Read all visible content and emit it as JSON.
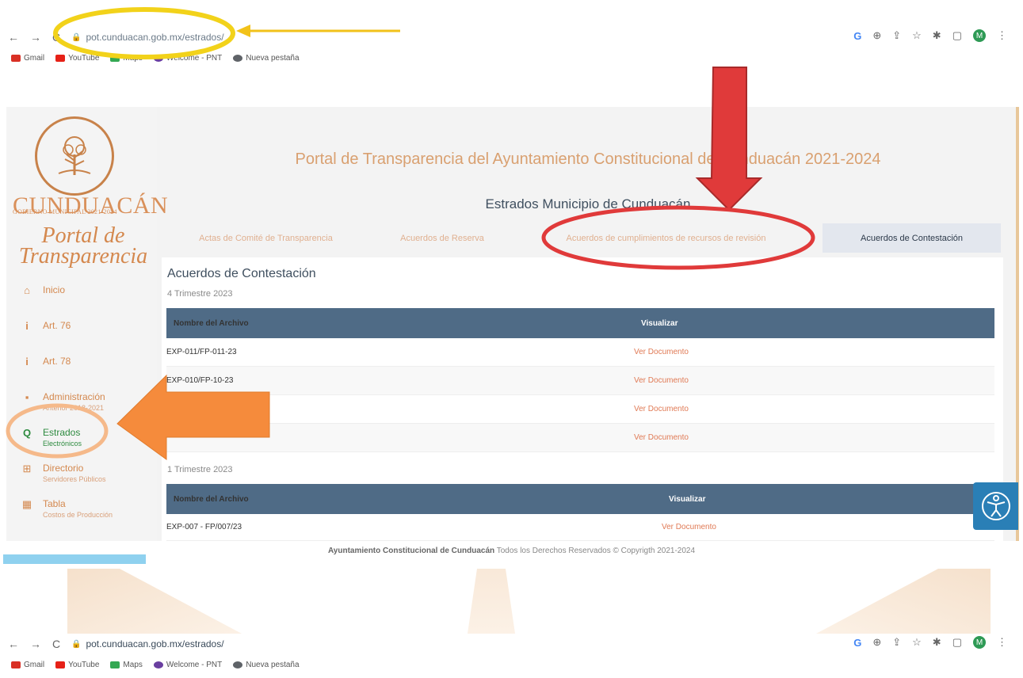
{
  "browser": {
    "url_top": "pot.cunduacan.gob.mx/estrados/",
    "url_bottom": "pot.cunduacan.gob.mx/estrados/",
    "avatar_letter": "M",
    "bookmarks": [
      {
        "label": "Gmail",
        "color": "#d93025"
      },
      {
        "label": "YouTube",
        "color": "#e62117"
      },
      {
        "label": "Maps",
        "color": "#34a853"
      },
      {
        "label": "Welcome - PNT",
        "color": "#6a3fa0"
      },
      {
        "label": "Nueva pestaña",
        "color": "#5f6368"
      }
    ]
  },
  "sidebar": {
    "brand": "CUNDUACÁN",
    "brand_sub": "GOBIERNO MUNICIPAL 2021-2024",
    "portal_title": "Portal de Transparencia",
    "items": [
      {
        "label": "Inicio",
        "sub": "",
        "icon": "home-icon",
        "glyph": "🏠"
      },
      {
        "label": "Art. 76",
        "sub": "",
        "icon": "info-icon",
        "glyph": "i"
      },
      {
        "label": "Art. 78",
        "sub": "",
        "icon": "info-icon",
        "glyph": "i"
      },
      {
        "label": "Administración",
        "sub": "Anterior 2018-2021",
        "icon": "briefcase-icon",
        "glyph": "▪"
      },
      {
        "label": "Estrados",
        "sub": "Electrónicos",
        "icon": "search-icon",
        "glyph": "⚲"
      },
      {
        "label": "Directorio",
        "sub": "Servidores Públicos",
        "icon": "sitemap-icon",
        "glyph": "⊞"
      },
      {
        "label": "Tabla",
        "sub": "Costos de Producción",
        "icon": "table-icon",
        "glyph": "▦"
      }
    ]
  },
  "header": {
    "title": "Portal de Transparencia del Ayuntamiento Constitucional de Cunduacán 2021-2024",
    "section": "Estrados Municipio de Cunduacán"
  },
  "tabs": [
    "Actas de Comité de Transparencia",
    "Acuerdos de Reserva",
    "Acuerdos de cumplimientos de recursos de revisión",
    "Acuerdos de Contestación"
  ],
  "content": {
    "title": "Acuerdos de Contestación",
    "sections": [
      {
        "quarter": "4 Trimestre 2023",
        "headers": [
          "Nombre del Archivo",
          "Visualizar"
        ],
        "rows": [
          {
            "name": "EXP-011/FP-011-23",
            "action": "Ver Documento"
          },
          {
            "name": "EXP-010/FP-10-23",
            "action": "Ver Documento"
          },
          {
            "name": "",
            "action": "Ver Documento"
          },
          {
            "name": "",
            "action": "Ver Documento"
          }
        ]
      },
      {
        "quarter": "1 Trimestre 2023",
        "headers": [
          "Nombre del Archivo",
          "Visualizar"
        ],
        "rows": [
          {
            "name": "EXP-007 - FP/007/23",
            "action": "Ver Documento"
          }
        ]
      }
    ]
  },
  "footer": {
    "bold": "Ayuntamiento Constitucional de Cunduacán",
    "rest": "Todos los Derechos Reservados © Copyrigth 2021-2024"
  },
  "annotations": {
    "yellow": "#f2d21a",
    "red": "#e03a3a",
    "orange": "#f58b3c"
  }
}
